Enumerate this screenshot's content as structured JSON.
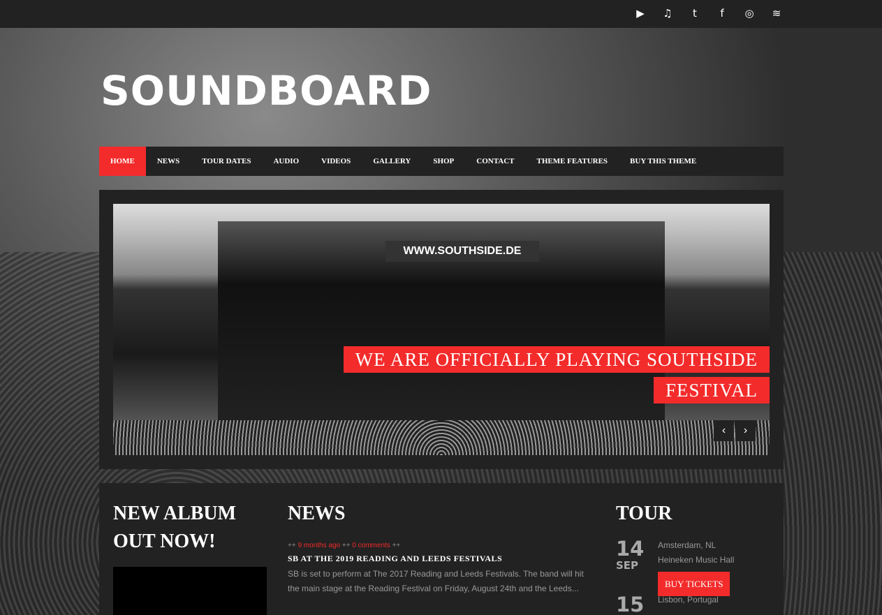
{
  "social": [
    {
      "icon": "youtube-icon",
      "glyph": "▶"
    },
    {
      "icon": "music-icon",
      "glyph": "♫"
    },
    {
      "icon": "twitter-icon",
      "glyph": "🐦"
    },
    {
      "icon": "facebook-icon",
      "glyph": "f"
    },
    {
      "icon": "instagram-icon",
      "glyph": "◎"
    },
    {
      "icon": "spotify-icon",
      "glyph": "≋"
    }
  ],
  "logo": "SOUNDBOARD",
  "nav": [
    "HOME",
    "NEWS",
    "TOUR DATES",
    "AUDIO",
    "VIDEOS",
    "GALLERY",
    "SHOP",
    "CONTACT",
    "THEME FEATURES",
    "BUY THIS THEME"
  ],
  "slider": {
    "stage_sign": "WWW.SOUTHSIDE.DE",
    "caption_line1": "WE ARE OFFICIALLY PLAYING SOUTHSIDE",
    "caption_line2": "FESTIVAL",
    "prev": "‹",
    "next": "›"
  },
  "album": {
    "title": "NEW ALBUM OUT NOW!"
  },
  "news": {
    "title": "NEWS",
    "sep": "++",
    "time": "9 months ago",
    "comments": "0 comments",
    "headline": "SB AT THE 2019 READING AND LEEDS FESTIVALS",
    "excerpt": "SB is set to perform at The 2017 Reading and Leeds Festivals. The band will hit the main stage at the Reading Festival on Friday, August 24th and the Leeds..."
  },
  "tour": {
    "title": "TOUR",
    "events": [
      {
        "day": "14",
        "month": "SEP",
        "city": "Amsterdam, NL",
        "venue": "Heineken Music Hall",
        "button": "BUY TICKETS"
      },
      {
        "day": "15",
        "city": "Lisbon, Portugal"
      }
    ]
  },
  "colors": {
    "accent": "#f32b2b",
    "panel": "#222222"
  }
}
